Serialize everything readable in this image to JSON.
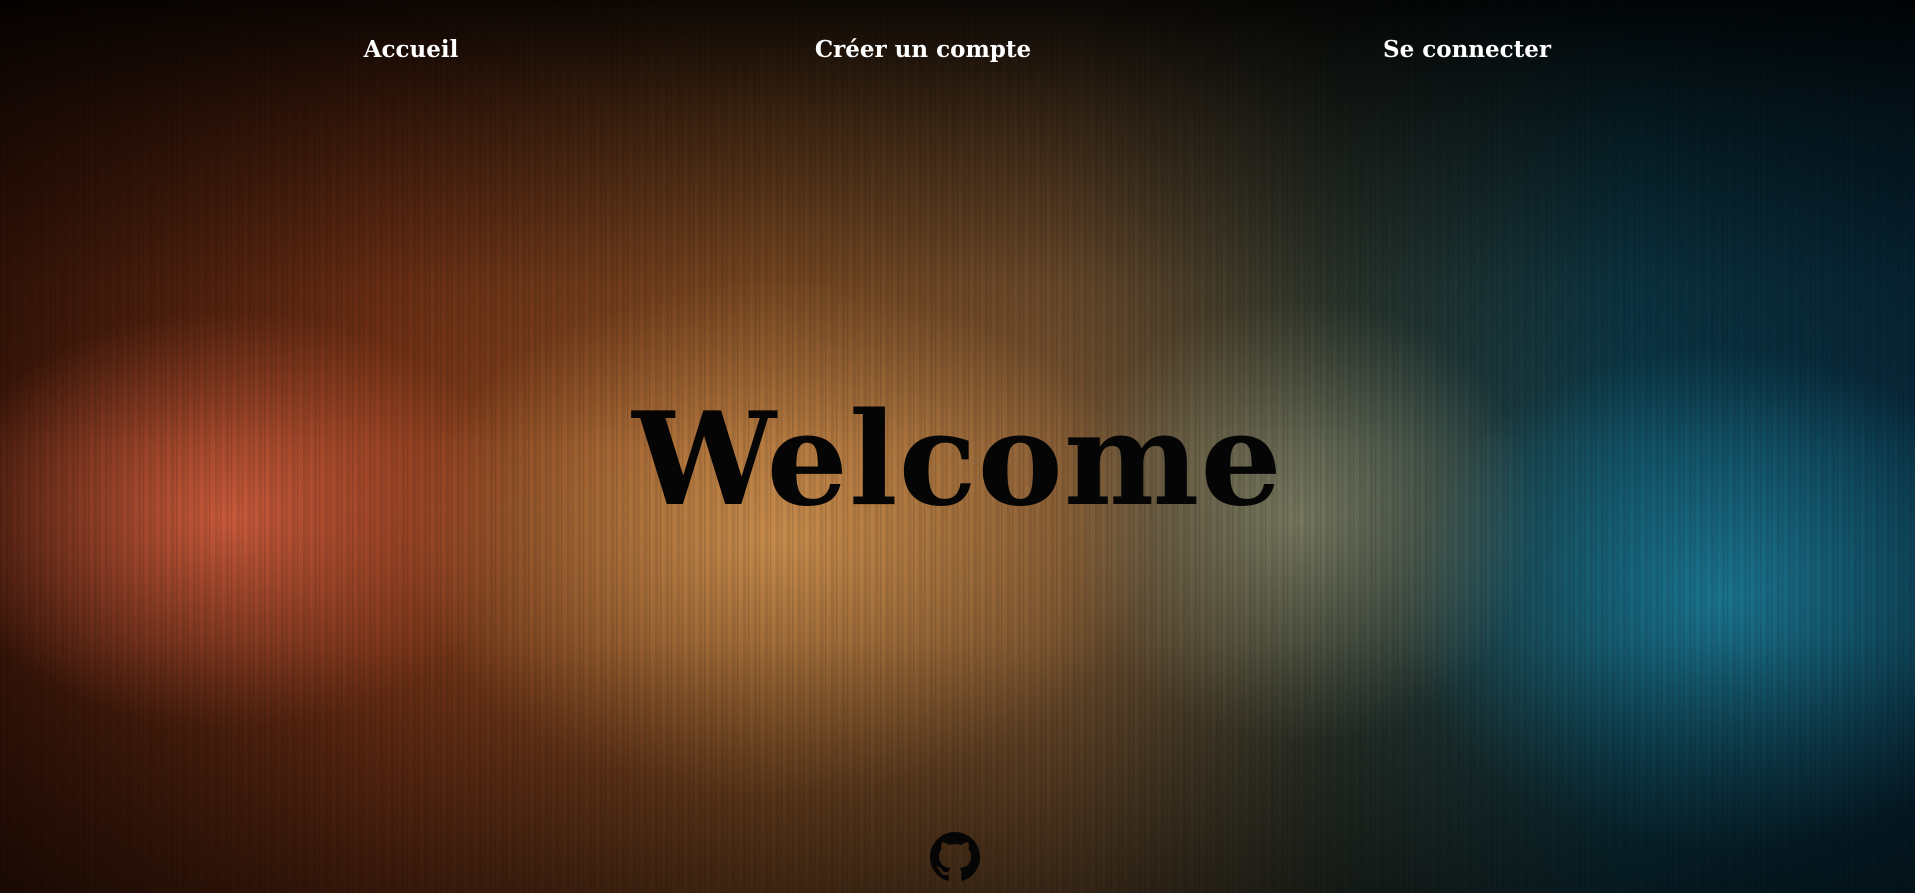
{
  "nav": {
    "home_label": "Accueil",
    "register_label": "Créer un compte",
    "login_label": "Se connecter"
  },
  "hero": {
    "title": "Welcome"
  },
  "footer": {
    "github_icon": "github-icon"
  },
  "colors": {
    "nav_text": "#ffffff",
    "title_text": "#050505",
    "bg_warm": "#d66040",
    "bg_gold": "#d49652",
    "bg_teal": "#1e82a0"
  }
}
